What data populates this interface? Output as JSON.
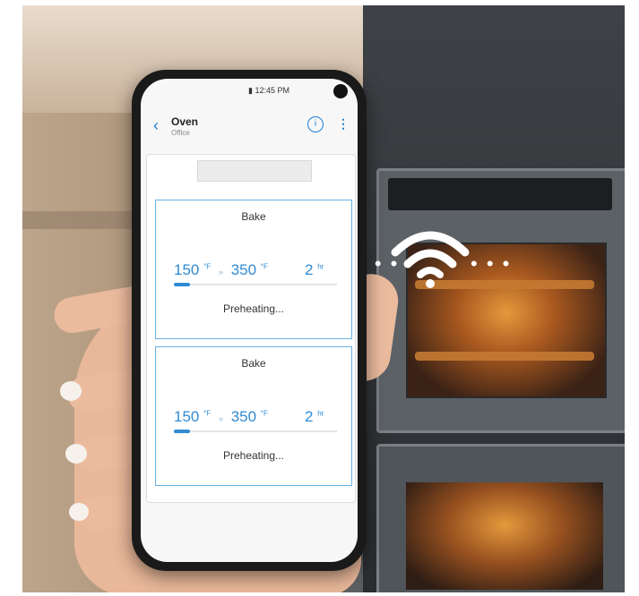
{
  "status_bar": {
    "time": "12:45 PM"
  },
  "app_bar": {
    "back_glyph": "‹",
    "title": "Oven",
    "subtitle": "Office",
    "info_glyph": "i",
    "more_glyph": "⋮"
  },
  "cards": [
    {
      "mode": "Bake",
      "current_temp": "150",
      "current_unit": "°F",
      "separator": "»",
      "target_temp": "350",
      "target_unit": "°F",
      "duration": "2",
      "duration_unit": "hr",
      "progress": 0.1,
      "state": "Preheating..."
    },
    {
      "mode": "Bake",
      "current_temp": "150",
      "current_unit": "°F",
      "separator": "»",
      "target_temp": "350",
      "target_unit": "°F",
      "duration": "2",
      "duration_unit": "hr",
      "progress": 0.1,
      "state": "Preheating..."
    }
  ],
  "decor": {
    "wifi_dots_left": "• • •",
    "wifi_dots_right": "• • •",
    "accent": "#2f8bd4",
    "icons": [
      "wifi-icon",
      "battery-icon",
      "info-icon",
      "more-icon",
      "back-icon"
    ]
  }
}
